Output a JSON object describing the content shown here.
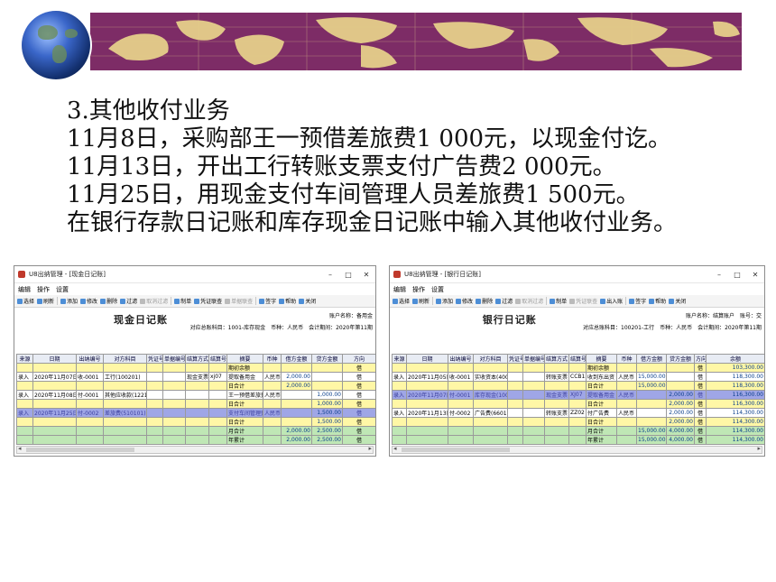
{
  "lines": [
    "3.其他收付业务",
    "11月8日，采购部王一预借差旅费1 000元，以现金付讫。",
    "11月13日，开出工行转账支票支付广告费2 000元。",
    "11月25日，用现金支付车间管理人员差旅费1 500元。",
    "在银行存款日记账和库存现金日记账中输入其他收付业务。"
  ],
  "left_window": {
    "title": "U8出纳管理 - [现金日记账]",
    "controls": [
      "–",
      "□",
      "✕"
    ],
    "menu": [
      "编辑",
      "操作",
      "设置"
    ],
    "toolbar": [
      "选择",
      "刷新",
      "添加",
      "修改",
      "删除",
      "过滤",
      "取消过滤",
      "制单",
      "凭证联查",
      "单据联查",
      "签字",
      "帮助",
      "关闭"
    ],
    "book_title": "现金日记账",
    "info1": "账户名称：备用金",
    "info2": "对应总账科目：1001-库存现金　币种：人民币　会计期间：2020年第11期",
    "columns": [
      "来源",
      "日期",
      "出纳编号",
      "对方科目",
      "凭证号",
      "单据编号",
      "结算方式",
      "结算号",
      "摘要",
      "币种",
      "借方金额",
      "贷方金额",
      "方向"
    ],
    "rows": [
      {
        "style": "y",
        "cells": [
          "",
          "",
          "",
          "",
          "",
          "",
          "",
          "",
          "期初余额",
          "",
          "",
          "",
          "借"
        ]
      },
      {
        "style": "w",
        "cells": [
          "录入",
          "2020年11月07日",
          "收-0001",
          "工行(100201)",
          "",
          "",
          "现金支票",
          "xj07",
          "提取备用金",
          "人民币",
          "2,000.00",
          "",
          "借"
        ]
      },
      {
        "style": "y",
        "cells": [
          "",
          "",
          "",
          "",
          "",
          "",
          "",
          "",
          "日合计",
          "",
          "2,000.00",
          "",
          "借"
        ]
      },
      {
        "style": "w",
        "cells": [
          "录入",
          "2020年11月08日",
          "付-0001",
          "其他应收款(1221)",
          "",
          "",
          "",
          "",
          "王一预借差旅费",
          "人民币",
          "",
          "1,000.00",
          "借"
        ]
      },
      {
        "style": "y",
        "cells": [
          "",
          "",
          "",
          "",
          "",
          "",
          "",
          "",
          "日合计",
          "",
          "",
          "1,000.00",
          "借"
        ]
      },
      {
        "style": "sel",
        "cells": [
          "录入",
          "2020年11月25日",
          "付-0002",
          "差旅费(510101)",
          "",
          "",
          "",
          "",
          "支付车间管理费",
          "人民币",
          "",
          "1,500.00",
          "借"
        ]
      },
      {
        "style": "y",
        "cells": [
          "",
          "",
          "",
          "",
          "",
          "",
          "",
          "",
          "日合计",
          "",
          "",
          "1,500.00",
          "借"
        ]
      },
      {
        "style": "g",
        "cells": [
          "",
          "",
          "",
          "",
          "",
          "",
          "",
          "",
          "月合计",
          "",
          "2,000.00",
          "2,500.00",
          "借"
        ]
      },
      {
        "style": "g",
        "cells": [
          "",
          "",
          "",
          "",
          "",
          "",
          "",
          "",
          "年累计",
          "",
          "2,000.00",
          "2,500.00",
          "借"
        ]
      }
    ]
  },
  "right_window": {
    "title": "U8出纳管理 - [银行日记账]",
    "controls": [
      "–",
      "□",
      "✕"
    ],
    "menu": [
      "编辑",
      "操作",
      "设置"
    ],
    "toolbar": [
      "选择",
      "刷新",
      "添加",
      "修改",
      "删除",
      "过滤",
      "取消过滤",
      "制单",
      "凭证联查",
      "出入账",
      "签字",
      "帮助",
      "关闭"
    ],
    "book_title": "银行日记账",
    "info1": "账户名称：结算账户　账号：交",
    "info2": "对应总账科目：100201-工行　币种：人民币　会计期间：2020年第11期",
    "columns": [
      "来源",
      "日期",
      "出纳编号",
      "对方科目",
      "凭证号",
      "单据编号",
      "结算方式",
      "结算号",
      "摘要",
      "币种",
      "借方金额",
      "贷方金额",
      "方向",
      "余额"
    ],
    "rows": [
      {
        "style": "y",
        "cells": [
          "",
          "",
          "",
          "",
          "",
          "",
          "",
          "",
          "期初余额",
          "",
          "",
          "",
          "借",
          "103,300.00"
        ]
      },
      {
        "style": "w",
        "cells": [
          "录入",
          "2020年11月05日",
          "收-0001",
          "实收资本(4001)",
          "",
          "",
          "转账支票",
          "CCB15",
          "收到东出资",
          "人民币",
          "15,000.00",
          "",
          "借",
          "118,300.00"
        ]
      },
      {
        "style": "y",
        "cells": [
          "",
          "",
          "",
          "",
          "",
          "",
          "",
          "",
          "日合计",
          "",
          "15,000.00",
          "",
          "借",
          "118,300.00"
        ]
      },
      {
        "style": "sel",
        "cells": [
          "录入",
          "2020年11月07日",
          "付-0001",
          "库存现金(1001)",
          "",
          "",
          "现金支票",
          "XJ07",
          "提取备用金",
          "人民币",
          "",
          "2,000.00",
          "借",
          "116,300.00"
        ]
      },
      {
        "style": "y",
        "cells": [
          "",
          "",
          "",
          "",
          "",
          "",
          "",
          "",
          "日合计",
          "",
          "",
          "2,000.00",
          "借",
          "116,300.00"
        ]
      },
      {
        "style": "w",
        "cells": [
          "录入",
          "2020年11月13日",
          "付-0002",
          "广告费(660101)",
          "",
          "",
          "转账支票",
          "ZZ02",
          "付广告费",
          "人民币",
          "",
          "2,000.00",
          "借",
          "114,300.00"
        ]
      },
      {
        "style": "y",
        "cells": [
          "",
          "",
          "",
          "",
          "",
          "",
          "",
          "",
          "日合计",
          "",
          "",
          "2,000.00",
          "借",
          "114,300.00"
        ]
      },
      {
        "style": "g",
        "cells": [
          "",
          "",
          "",
          "",
          "",
          "",
          "",
          "",
          "月合计",
          "",
          "15,000.00",
          "4,000.00",
          "借",
          "114,300.00"
        ]
      },
      {
        "style": "g",
        "cells": [
          "",
          "",
          "",
          "",
          "",
          "",
          "",
          "",
          "年累计",
          "",
          "15,000.00",
          "4,000.00",
          "借",
          "114,300.00"
        ]
      }
    ]
  },
  "colors": {
    "map_band": "#7d2c66",
    "day_total_row": "#fff7a6",
    "summary_row": "#bfe7b5",
    "selected_row": "#9fa6e6"
  }
}
